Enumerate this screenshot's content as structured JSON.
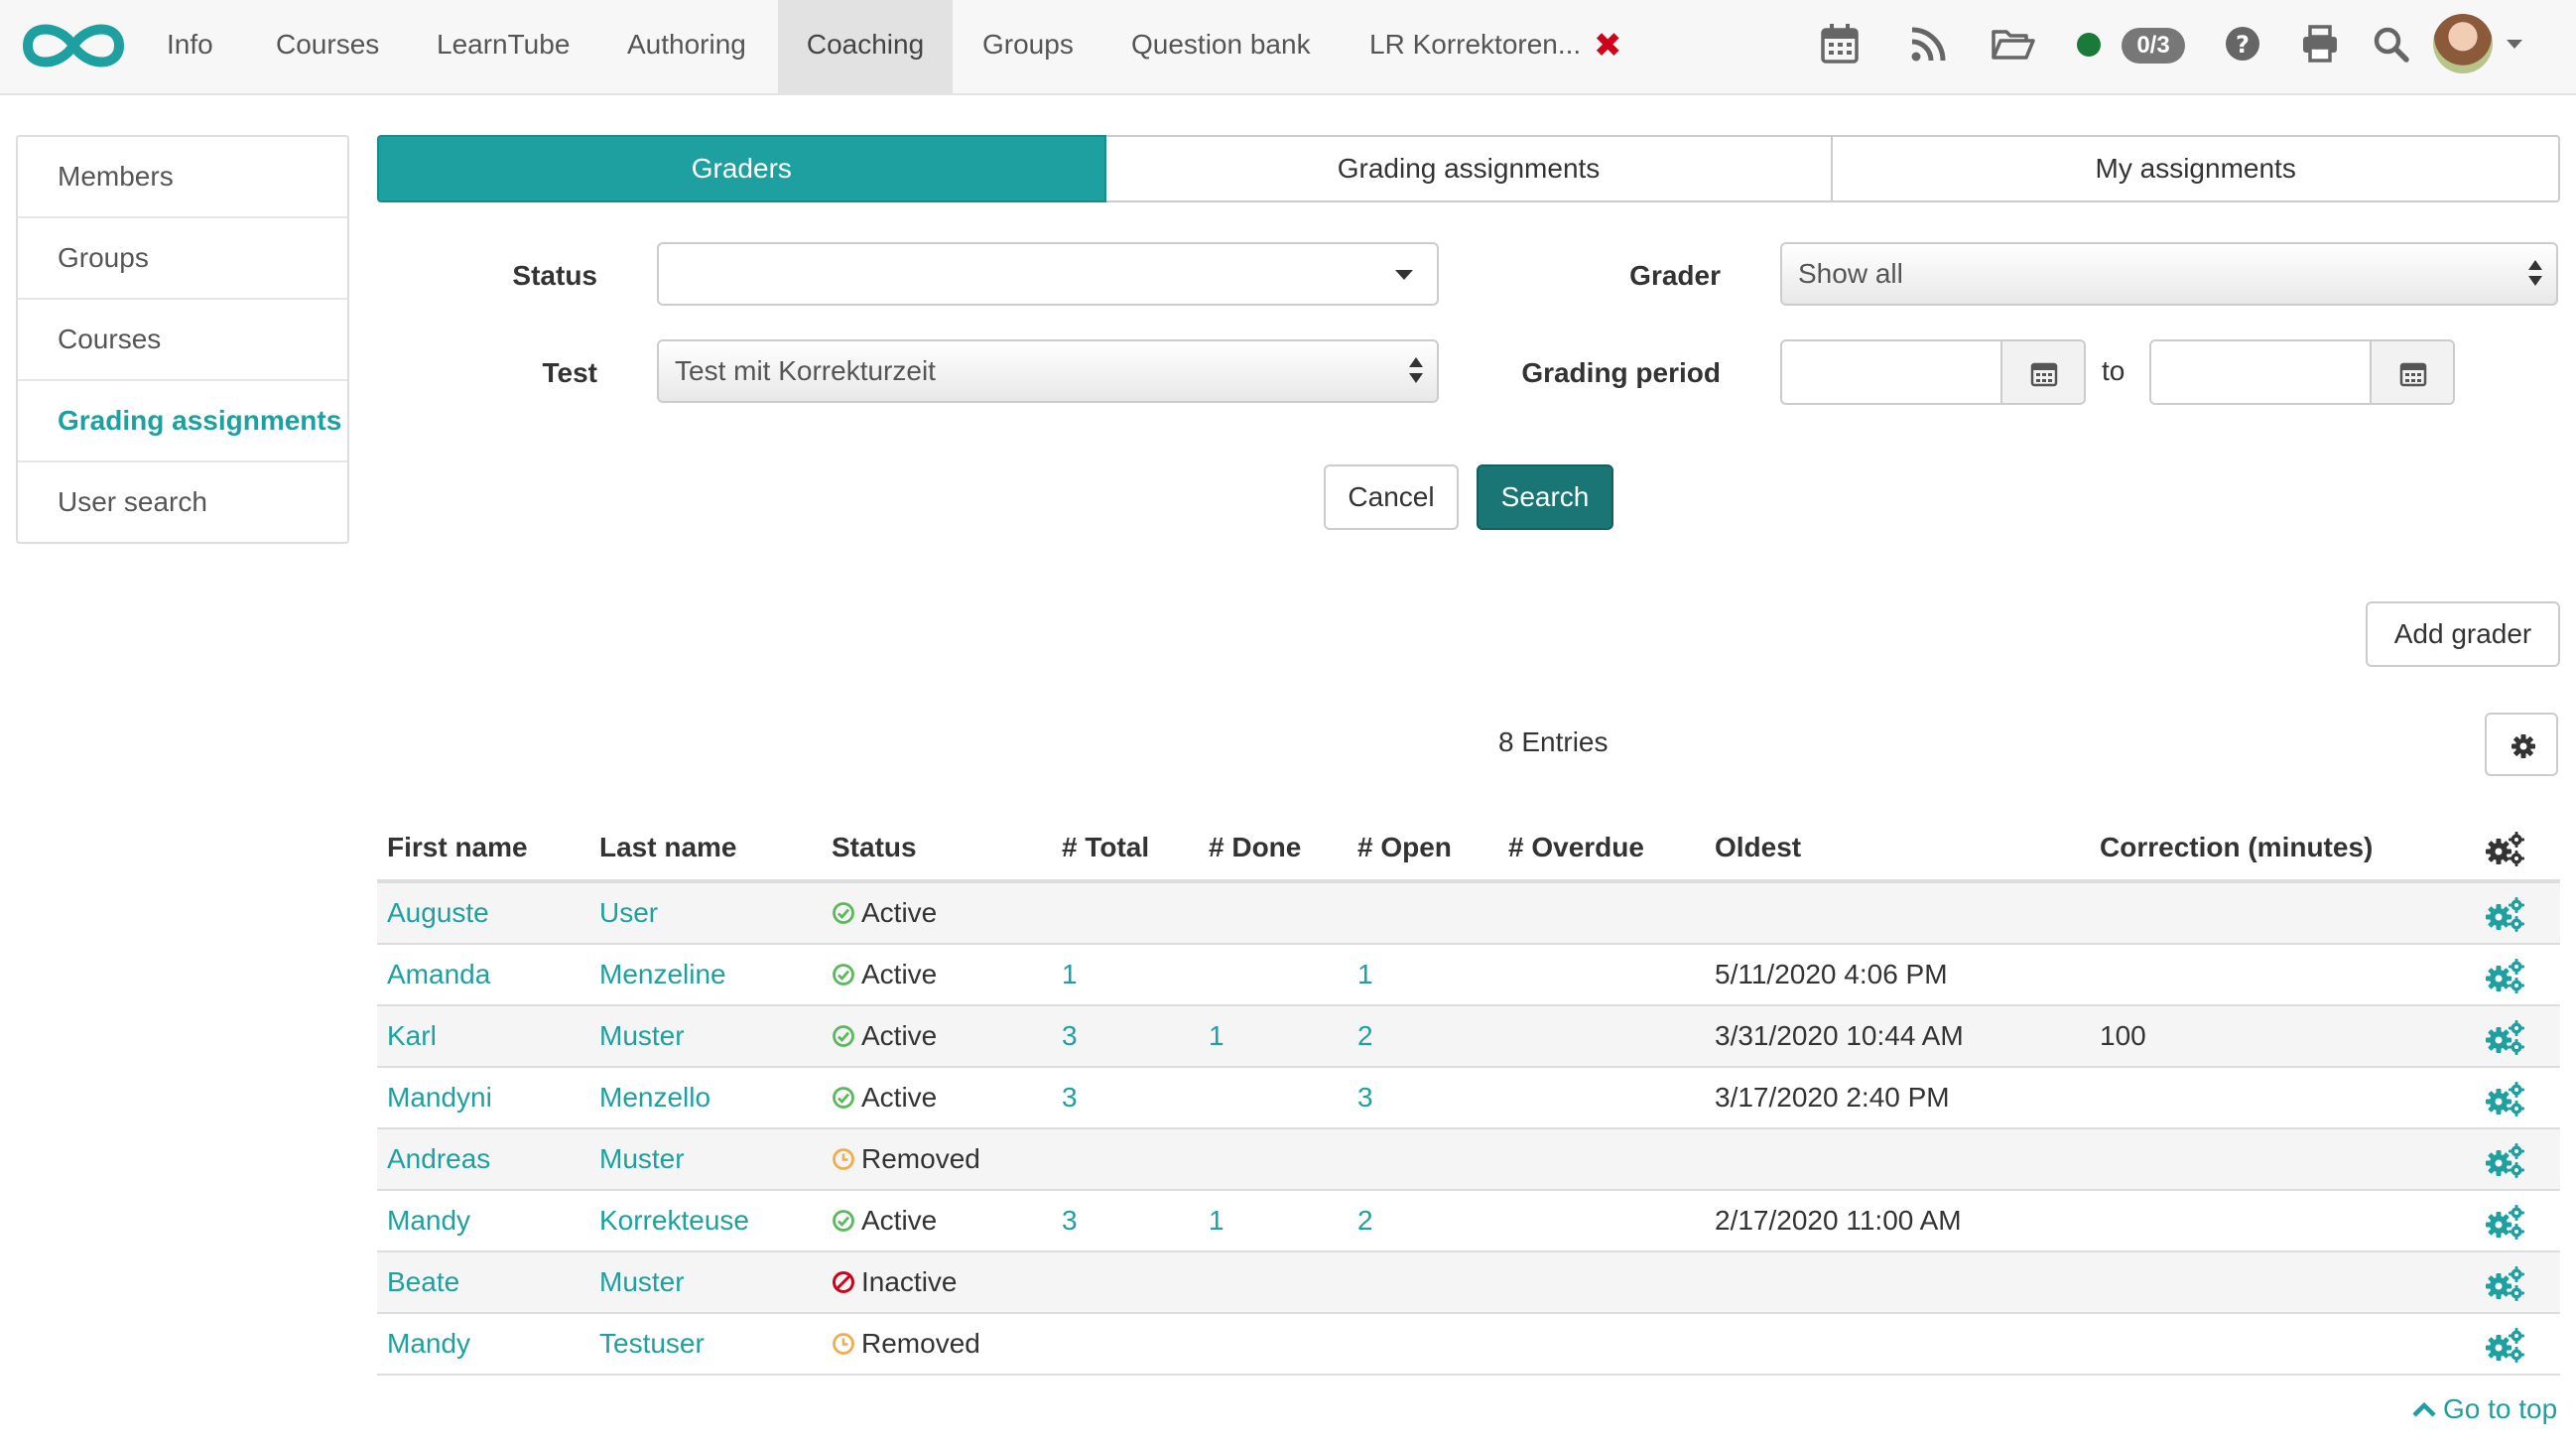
{
  "topnav": {
    "items": [
      {
        "label": "Info"
      },
      {
        "label": "Courses"
      },
      {
        "label": "LearnTube"
      },
      {
        "label": "Authoring"
      },
      {
        "label": "Coaching",
        "active": true
      },
      {
        "label": "Groups"
      },
      {
        "label": "Question bank"
      },
      {
        "label": "LR Korrektoren..."
      }
    ],
    "badge": "0/3",
    "icons": [
      "calendar-icon",
      "rss-icon",
      "folder-open-icon",
      "online-status-icon",
      "help-icon",
      "print-icon",
      "search-icon",
      "avatar",
      "chevron-down-icon"
    ],
    "status_color": "#1a7a3a",
    "close_color": "#d0021b"
  },
  "sidebar": {
    "items": [
      {
        "label": "Members"
      },
      {
        "label": "Groups"
      },
      {
        "label": "Courses"
      },
      {
        "label": "Grading assignments",
        "active": true
      },
      {
        "label": "User search"
      }
    ]
  },
  "tabs": [
    {
      "label": "Graders",
      "active": true
    },
    {
      "label": "Grading assignments"
    },
    {
      "label": "My assignments"
    }
  ],
  "form": {
    "status_label": "Status",
    "status_value": "",
    "test_label": "Test",
    "test_value": "Test mit Korrekturzeit",
    "grader_label": "Grader",
    "grader_value": "Show all",
    "period_label": "Grading period",
    "to_label": "to",
    "period_from": "",
    "period_to": "",
    "cancel_label": "Cancel",
    "search_label": "Search"
  },
  "actions": {
    "add_grader_label": "Add grader",
    "entries_label": "8 Entries"
  },
  "table": {
    "columns": [
      "First name",
      "Last name",
      "Status",
      "# Total",
      "# Done",
      "# Open",
      "# Overdue",
      "Oldest",
      "Correction (minutes)"
    ],
    "rows": [
      {
        "first": "Auguste",
        "last": "User",
        "status": "Active",
        "status_type": "active",
        "total": "",
        "done": "",
        "open": "",
        "overdue": "",
        "oldest": "",
        "correction": ""
      },
      {
        "first": "Amanda",
        "last": "Menzeline",
        "status": "Active",
        "status_type": "active",
        "total": "1",
        "done": "",
        "open": "1",
        "overdue": "",
        "oldest": "5/11/2020 4:06 PM",
        "correction": ""
      },
      {
        "first": "Karl",
        "last": "Muster",
        "status": "Active",
        "status_type": "active",
        "total": "3",
        "done": "1",
        "open": "2",
        "overdue": "",
        "oldest": "3/31/2020 10:44 AM",
        "correction": "100"
      },
      {
        "first": "Mandyni",
        "last": "Menzello",
        "status": "Active",
        "status_type": "active",
        "total": "3",
        "done": "",
        "open": "3",
        "overdue": "",
        "oldest": "3/17/2020 2:40 PM",
        "correction": ""
      },
      {
        "first": "Andreas",
        "last": "Muster",
        "status": "Removed",
        "status_type": "removed",
        "total": "",
        "done": "",
        "open": "",
        "overdue": "",
        "oldest": "",
        "correction": ""
      },
      {
        "first": "Mandy",
        "last": "Korrekteuse",
        "status": "Active",
        "status_type": "active",
        "total": "3",
        "done": "1",
        "open": "2",
        "overdue": "",
        "oldest": "2/17/2020 11:00 AM",
        "correction": ""
      },
      {
        "first": "Beate",
        "last": "Muster",
        "status": "Inactive",
        "status_type": "inactive",
        "total": "",
        "done": "",
        "open": "",
        "overdue": "",
        "oldest": "",
        "correction": ""
      },
      {
        "first": "Mandy",
        "last": "Testuser",
        "status": "Removed",
        "status_type": "removed",
        "total": "",
        "done": "",
        "open": "",
        "overdue": "",
        "oldest": "",
        "correction": ""
      }
    ]
  },
  "footer": {
    "go_top_label": "Go to top"
  },
  "colors": {
    "accent": "#1fa0a0",
    "primary_button": "#1a7575",
    "active_status": "#5cb85c",
    "removed_status": "#f0ad4e",
    "inactive_status": "#d0021b"
  }
}
